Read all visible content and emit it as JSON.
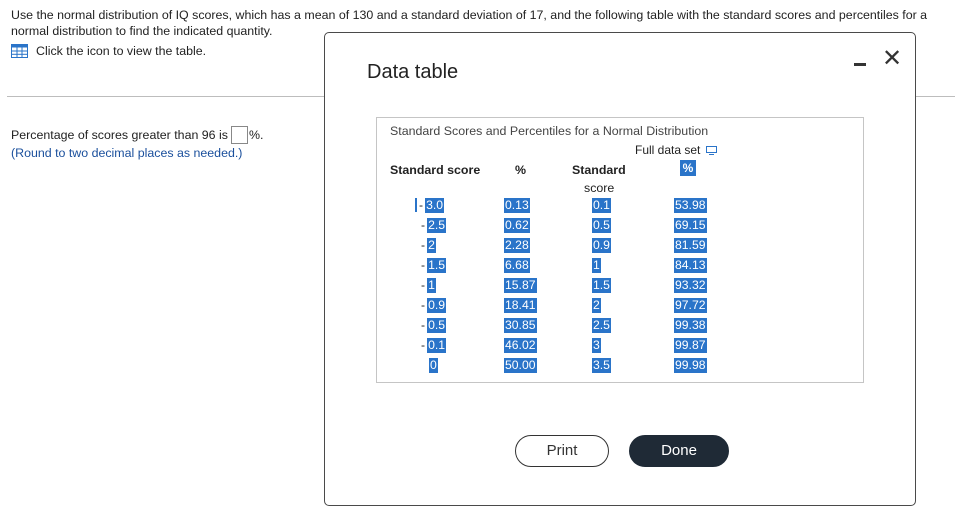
{
  "question": {
    "text": "Use the normal distribution of IQ scores, which has a mean of 130 and a standard deviation of 17, and the following table with the standard scores and percentiles for a normal distribution to find the indicated quantity.",
    "table_link": "Click the icon to view the table.",
    "answer_prefix": "Percentage of scores greater than 96 is",
    "answer_suffix": "%.",
    "answer_value": "",
    "hint": "(Round to two decimal places as needed.)"
  },
  "dialog": {
    "title": "Data table",
    "caption": "Standard Scores and Percentiles for a Normal Distribution",
    "full_data_label": "Full data set",
    "headers": {
      "standard_score": "Standard score",
      "percent": "%",
      "standard_score_2_line1": "Standard",
      "standard_score_2_line2": "score",
      "percent_2": "%"
    },
    "left_scores": [
      "3.0",
      "2.5",
      "2",
      "1.5",
      "1",
      "0.9",
      "0.5",
      "0.1",
      "0"
    ],
    "left_percents": [
      "0.13",
      "0.62",
      "2.28",
      "6.68",
      "15.87",
      "18.41",
      "30.85",
      "46.02",
      "50.00"
    ],
    "right_scores": [
      "0.1",
      "0.5",
      "0.9",
      "1",
      "1.5",
      "2",
      "2.5",
      "3",
      "3.5"
    ],
    "right_percents": [
      "53.98",
      "69.15",
      "81.59",
      "84.13",
      "93.32",
      "97.72",
      "99.38",
      "99.87",
      "99.98"
    ],
    "print_label": "Print",
    "done_label": "Done",
    "close_symbol": "✕"
  },
  "colors": {
    "highlight": "#2a74c9",
    "hint_text": "#1a4f9c",
    "done_button": "#1f2a36"
  },
  "icons": [
    "table-grid-icon",
    "copy-icon",
    "minimize-icon",
    "close-icon"
  ]
}
